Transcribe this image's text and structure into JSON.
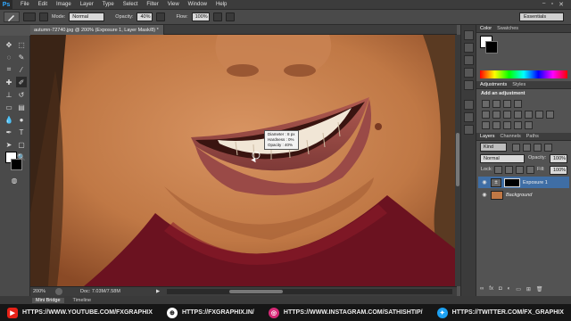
{
  "menubar": {
    "logo": "Ps",
    "items": [
      "File",
      "Edit",
      "Image",
      "Layer",
      "Type",
      "Select",
      "Filter",
      "View",
      "Window",
      "Help"
    ],
    "controls": [
      "−",
      "▫",
      "✕"
    ]
  },
  "options": {
    "mode_label": "Mode:",
    "mode_value": "Normal",
    "opacity_label": "Opacity:",
    "opacity_value": "40%",
    "flow_label": "Flow:",
    "flow_value": "100%",
    "workspace": "Essentials"
  },
  "document": {
    "tab_title": "autumn-72740.jpg @ 200% (Exposure 1, Layer Mask/8) *",
    "zoom": "200%",
    "doc_info": "Doc: 7.03M/7.58M"
  },
  "brush_tooltip": {
    "lines": [
      "Diameter : 8 px",
      "Hardness : 0%",
      "Opacity : 40%"
    ]
  },
  "bottom_tabs": [
    "Mini Bridge",
    "Timeline"
  ],
  "panels": {
    "color_tabs": [
      "Color",
      "Swatches"
    ],
    "adjust_tabs": [
      "Adjustments",
      "Styles"
    ],
    "adjust_title": "Add an adjustment",
    "layer_tabs": [
      "Layers",
      "Channels",
      "Paths"
    ],
    "kind_label": "Kind",
    "blend_mode": "Normal",
    "opacity_label": "Opacity:",
    "opacity_value": "100%",
    "lock_label": "Lock:",
    "fill_label": "Fill:",
    "fill_value": "100%",
    "layers": [
      {
        "name": "Exposure 1"
      },
      {
        "name": "Background"
      }
    ]
  },
  "footer": {
    "youtube": "HTTPS://WWW.YOUTUBE.COM/FXGRAPHIX",
    "web": "HTTPS://FXGRAPHIX.IN/",
    "instagram": "HTTPS://WWW.INSTAGRAM.COM/SATHISHTIP/",
    "twitter": "HTTPS://TWITTER.COM/FX_GRAPHIX"
  },
  "colors": {
    "skin": "#c07845",
    "lip": "#9a4a47",
    "sweater": "#6b1220",
    "hair": "#3a2416"
  }
}
